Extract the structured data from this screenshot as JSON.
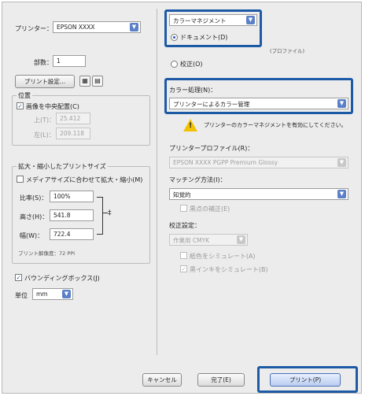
{
  "printer": {
    "label": "プリンター：",
    "value": "EPSON XXXX"
  },
  "copies": {
    "label": "部数：",
    "value": "1"
  },
  "page_setup_button": "プリント設定...",
  "position": {
    "title": "位置",
    "center_label": "画像を中央配置(C)",
    "top_label": "上(T)：",
    "top_value": "25.412",
    "left_label": "左(L)：",
    "left_value": "209.118"
  },
  "scaling": {
    "title": "拡大・縮小したプリントサイズ",
    "fit_media_label": "メディアサイズに合わせて拡大・縮小(M)",
    "scale_label": "比率(S)：",
    "scale_value": "100%",
    "height_label": "高さ(H)：",
    "height_value": "541.8",
    "width_label": "幅(W)：",
    "width_value": "722.4",
    "resolution_label": "プリント解像度：72 PPI"
  },
  "bounding_box_label": "バウンディングボックス(J)",
  "units": {
    "label": "単位",
    "value": "mm"
  },
  "color_management": {
    "dropdown": "カラーマネジメント",
    "document_radio": "ドキュメント(D)",
    "document_profile": "(プロファイル)",
    "proof_radio": "校正(O)"
  },
  "color_handling": {
    "label": "カラー処理(N)：",
    "value": "プリンターによるカラー管理",
    "warning": "プリンターのカラーマネジメントを有効にしてください。"
  },
  "printer_profile": {
    "label": "プリンタープロファイル(R)：",
    "value": "EPSON XXXX PGPP Premium Glossy"
  },
  "rendering_intent": {
    "label": "マッチング方法(I)：",
    "value": "知覚的",
    "bpc_label": "黒点の補正(E)"
  },
  "proof_setup": {
    "label": "校正設定：",
    "value": "作業用 CMYK",
    "simulate_paper": "紙色をシミュレート(A)",
    "simulate_black": "黒インキをシミュレート(B)"
  },
  "buttons": {
    "cancel": "キャンセル",
    "done": "完了(E)",
    "print": "プリント(P)"
  },
  "colors": {
    "highlight": "#1d5aa6",
    "accent": "#5a80c8"
  }
}
